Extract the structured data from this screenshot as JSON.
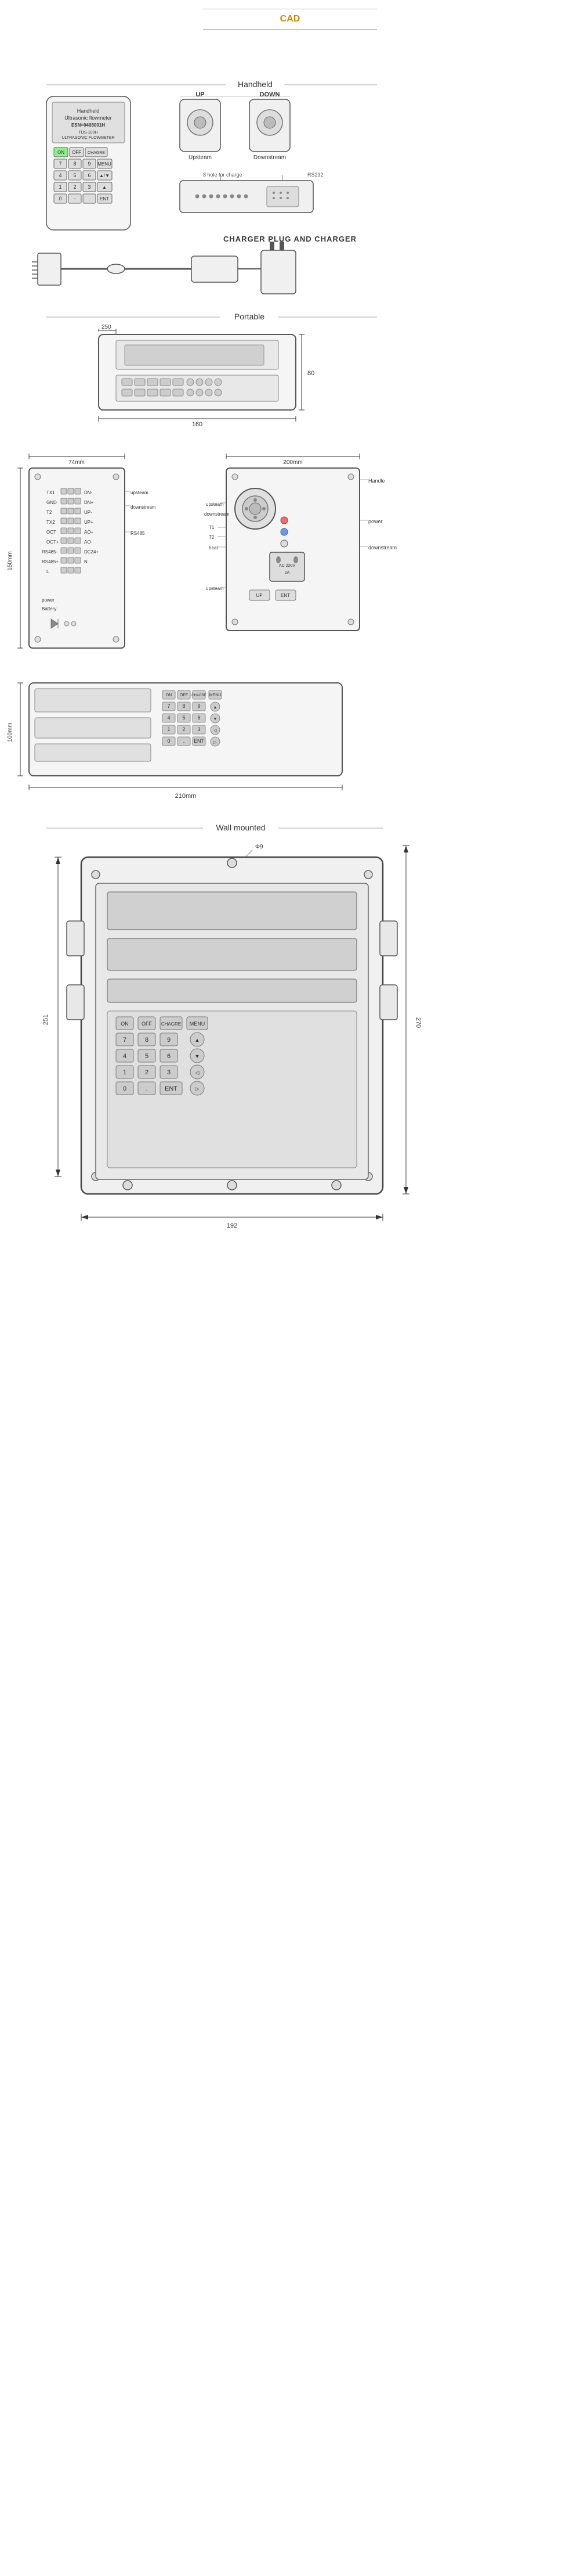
{
  "page": {
    "title": "CAD",
    "background": "#ffffff"
  },
  "sections": {
    "cad_label": "CAD",
    "handheld_label": "Handheld",
    "portable_label": "Portable",
    "wall_mounted_label": "Wall mounted"
  },
  "handheld": {
    "device": {
      "title": "Handheld",
      "subtitle": "Ultrasonic flowmeter",
      "model": "TDS-100H",
      "type": "ULTRASONIC FLOWMETER",
      "esn": "ESN=0408001H",
      "keys": {
        "row1": [
          "ON",
          "OFF",
          "CHAGRE"
        ],
        "row2": [
          "7",
          "8",
          "9",
          "MENU"
        ],
        "row3": [
          "4",
          "5",
          "6",
          "▲/▼"
        ],
        "row4": [
          "1",
          "2",
          "3",
          "▲"
        ],
        "row5": [
          "0",
          "-",
          ".",
          "ENT"
        ]
      }
    },
    "probes": {
      "up_label": "UP",
      "down_label": "DOWN",
      "upstream_label": "Upsteam",
      "downstream_label": "Downstream"
    },
    "bottom_view": {
      "charge_label": "8 hole for charge",
      "rs232_label": "RS232"
    }
  },
  "charger": {
    "title": "CHARGER PLUG AND CHARGER"
  },
  "portable": {
    "dimensions": {
      "width": "160",
      "height": "80",
      "depth": "250"
    },
    "detail": {
      "width_mm": "74mm",
      "height_mm": "150mm",
      "depth_mm": "200mm",
      "terminals_left": [
        "TX1",
        "GND",
        "T2",
        "TX2",
        "OCT",
        "OCT+",
        "RS485-",
        "RS485+",
        "L"
      ],
      "terminals_right": [
        "DN-",
        "DN+",
        "UP-",
        "UP+",
        "AO+",
        "AO-",
        "DC24+",
        "N"
      ],
      "labels_right": [
        "upsteam",
        "downstream",
        "RS485",
        "T1",
        "T2",
        "heat",
        "upsteam"
      ]
    },
    "right_side": {
      "handle_label": "Handle",
      "power_label": "power",
      "downstream_label": "downstream",
      "ac_label": "AC 220V, 2A",
      "up_label": "UP",
      "ent_label": "ENT"
    }
  },
  "panel": {
    "dimensions": {
      "width_mm": "210mm",
      "height_mm": "100mm"
    }
  },
  "wall_mounted": {
    "dimensions": {
      "width": "192",
      "height_left": "251",
      "height_right": "270",
      "hole_size": "Φ9"
    }
  }
}
